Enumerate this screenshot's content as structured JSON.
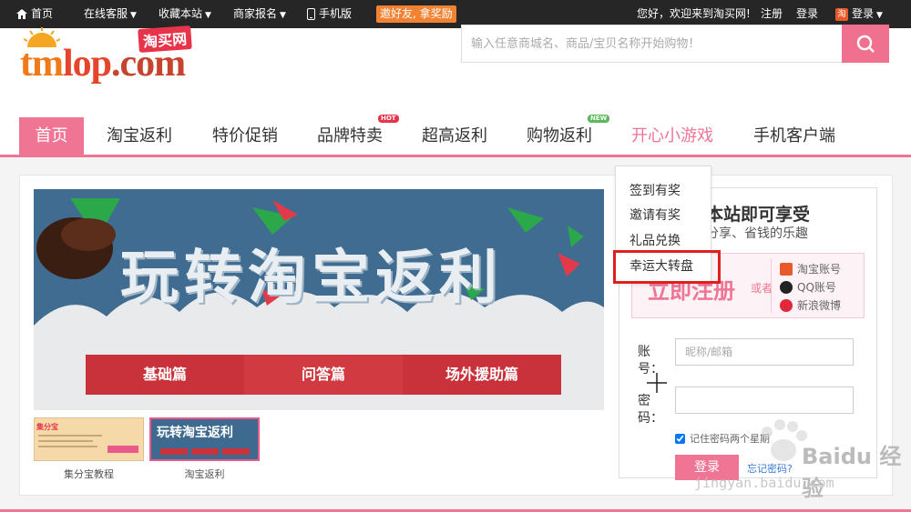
{
  "topbar": {
    "home": "首页",
    "online_service": "在线客服",
    "bookmark": "收藏本站",
    "merchant": "商家报名",
    "mobile": "手机版",
    "promo": "邀好友, 拿奖励",
    "welcome": "您好，欢迎来到淘买网!",
    "register": "注册",
    "login": "登录",
    "taobao_login": "登录"
  },
  "header": {
    "logo_main_1": "tm",
    "logo_main_2": "lop",
    "logo_main_3": ".com",
    "logo_cn": "淘买网",
    "search_placeholder": "输入任意商城名、商品/宝贝名称开始购物！"
  },
  "nav": {
    "items": [
      {
        "label": "首页"
      },
      {
        "label": "淘宝返利"
      },
      {
        "label": "特价促销"
      },
      {
        "label": "品牌特卖",
        "tag": "HOT"
      },
      {
        "label": "超高返利"
      },
      {
        "label": "购物返利",
        "tag": "NEW"
      },
      {
        "label": "开心小游戏"
      },
      {
        "label": "手机客户端"
      }
    ]
  },
  "dropdown": {
    "items": [
      "签到有奖",
      "邀请有奖",
      "礼品兑换",
      "幸运大转盘"
    ]
  },
  "banner": {
    "title": "玩转淘宝返利",
    "buttons": [
      "基础篇",
      "问答篇",
      "场外援助篇"
    ]
  },
  "thumbs": [
    {
      "label": "集分宝教程",
      "logo": "集分宝"
    },
    {
      "label": "淘宝返利",
      "title": "玩转淘宝返利"
    }
  ],
  "login_panel": {
    "title": "本站即可享受",
    "subtitle": "分享、省钱的乐趣",
    "register_big": "立即注册",
    "or": "或者",
    "socials": [
      "淘宝账号",
      "QQ账号",
      "新浪微博"
    ],
    "account_label": "账号：",
    "account_placeholder": "昵称/邮箱",
    "password_label": "密码：",
    "remember": "记住密码两个星期",
    "login_btn": "登录",
    "forgot": "忘记密码?"
  },
  "watermark": {
    "text": "Baidu 经验",
    "url": "jingyan.baidu.com"
  },
  "colors": {
    "accent": "#f07595",
    "topbar": "#262626",
    "promo": "#f08232",
    "highlight": "#e02020"
  }
}
